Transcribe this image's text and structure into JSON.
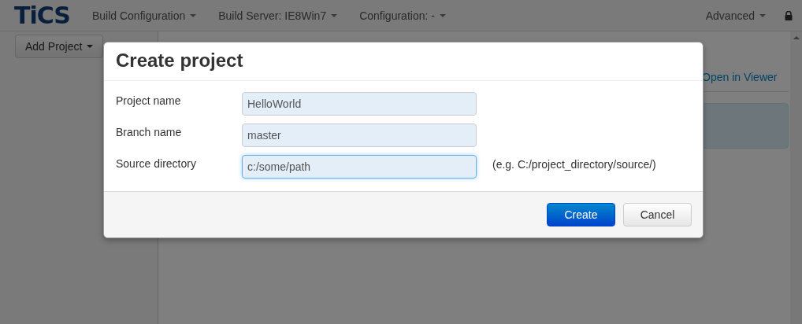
{
  "navbar": {
    "logo": "TiCS",
    "menus": [
      {
        "label": "Build Configuration"
      },
      {
        "label": "Build Server: IE8Win7"
      },
      {
        "label": "Configuration: -"
      }
    ],
    "right_menu": {
      "label": "Advanced"
    }
  },
  "sidebar": {
    "add_button": {
      "label": "Add Project"
    }
  },
  "main": {
    "link": "Open in Viewer"
  },
  "dialog": {
    "title": "Create project",
    "fields": [
      {
        "label": "Project name",
        "value": "HelloWorld",
        "focused": false
      },
      {
        "label": "Branch name",
        "value": "master",
        "focused": false
      },
      {
        "label": "Source directory",
        "value": "c:/some/path",
        "focused": true,
        "hint": "(e.g. C:/project_directory/source/)"
      }
    ],
    "buttons": [
      {
        "label": "Create",
        "kind": "primary"
      },
      {
        "label": "Cancel",
        "kind": "default"
      }
    ]
  }
}
